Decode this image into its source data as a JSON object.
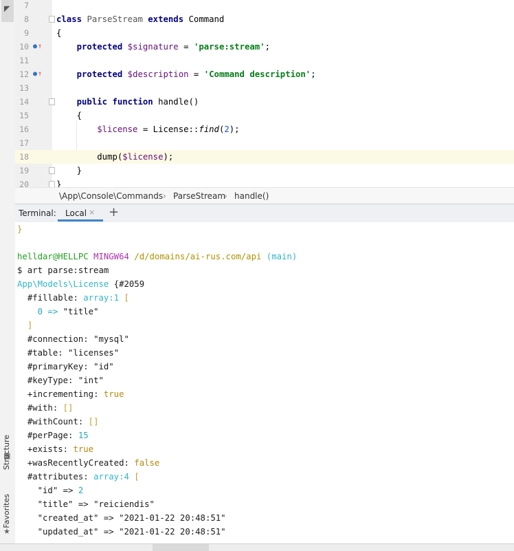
{
  "sidebar": {
    "structure_label": "Structure",
    "favorites_label": "Favorites"
  },
  "editor": {
    "lines": [
      {
        "n": "7"
      },
      {
        "n": "8"
      },
      {
        "n": "9"
      },
      {
        "n": "10"
      },
      {
        "n": "11"
      },
      {
        "n": "12"
      },
      {
        "n": "13"
      },
      {
        "n": "14"
      },
      {
        "n": "15"
      },
      {
        "n": "16"
      },
      {
        "n": "17"
      },
      {
        "n": "18"
      },
      {
        "n": "19"
      },
      {
        "n": "20"
      }
    ],
    "tokens": {
      "l8_kw1": "class",
      "l8_name": "ParseStream",
      "l8_kw2": "extends",
      "l8_parent": "Command",
      "l9": "{",
      "l10_kw": "protected",
      "l10_var": "$signature",
      "l10_eq": " = ",
      "l10_str": "'parse:stream'",
      "l10_end": ";",
      "l12_kw": "protected",
      "l12_var": "$description",
      "l12_eq": " = ",
      "l12_str": "'Command description'",
      "l12_end": ";",
      "l14_kw1": "public",
      "l14_kw2": "function",
      "l14_fn": "handle()",
      "l15": "{",
      "l16_var": "$license",
      "l16_mid": " = License::",
      "l16_fn": "find",
      "l16_open": "(",
      "l16_num": "2",
      "l16_close": ");",
      "l18_fn": "dump(",
      "l18_var": "$license",
      "l18_end": ");",
      "l19": "}",
      "l20": "}"
    }
  },
  "breadcrumb": {
    "items": [
      "\\App\\Console\\Commands",
      "ParseStream",
      "handle()"
    ],
    "separator": "›"
  },
  "terminal_bar": {
    "title": "Terminal:",
    "tab_label": "Local",
    "close_glyph": "×",
    "add_glyph": "+"
  },
  "terminal": {
    "prev_brace": "}",
    "prompt_user": "helldar@HELLPC",
    "prompt_shell": "MINGW64",
    "prompt_path": "/d/domains/ai-rus.com/api",
    "prompt_branch": "(main)",
    "command": "$ art parse:stream",
    "dump_class": "App\\Models\\License",
    "dump_open": " {",
    "dump_id": "#2059",
    "rows": {
      "fillable_key": "#fillable",
      "fillable_val": "array:1",
      "fillable_br": " [",
      "fill0_idx": "0",
      "fill0_arrow": " => ",
      "fill0_val": "\"title\"",
      "fill_close": "]",
      "connection_key": "#connection",
      "connection_val": "\"mysql\"",
      "table_key": "#table",
      "table_val": "\"licenses\"",
      "primaryKey_key": "#primaryKey",
      "primaryKey_val": "\"id\"",
      "keyType_key": "#keyType",
      "keyType_val": "\"int\"",
      "incrementing_key": "+incrementing",
      "incrementing_val": "true",
      "with_key": "#with",
      "with_val": "[]",
      "withCount_key": "#withCount",
      "withCount_val": "[]",
      "perPage_key": "#perPage",
      "perPage_val": "15",
      "exists_key": "+exists",
      "exists_val": "true",
      "wasRecentlyCreated_key": "+wasRecentlyCreated",
      "wasRecentlyCreated_val": "false",
      "attributes_key": "#attributes",
      "attributes_val": "array:4",
      "attributes_br": " [",
      "attr_id_k": "\"id\"",
      "attr_id_v": "2",
      "attr_title_k": "\"title\"",
      "attr_title_v": "\"reiciendis\"",
      "attr_created_k": "\"created_at\"",
      "attr_created_v": "\"2021-01-22 20:48:51\"",
      "attr_updated_k": "\"updated_at\"",
      "attr_updated_v": "\"2021-01-22 20:48:51\""
    }
  }
}
